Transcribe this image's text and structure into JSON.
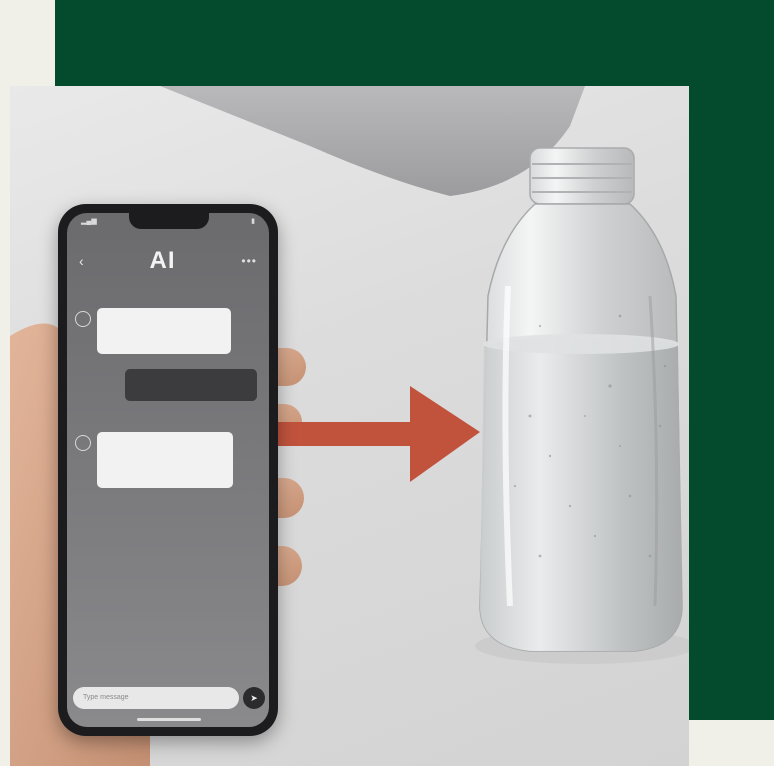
{
  "colors": {
    "page_background": "#f0efe8",
    "green_panel": "#034b2c",
    "arrow": "#c1533d"
  },
  "phone": {
    "header_title": "AI",
    "back_icon": "chevron-left-icon",
    "more_icon": "ellipsis-icon",
    "input_placeholder": "Type message"
  }
}
